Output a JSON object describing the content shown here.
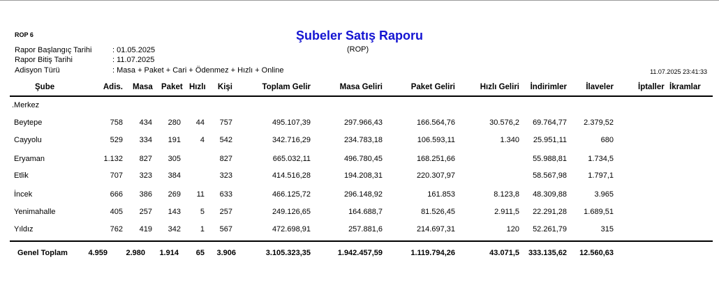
{
  "report": {
    "code": "ROP 6",
    "title": "Şubeler Satış Raporu",
    "subtitle": "(ROP)",
    "timestamp": "11.07.2025 23:41:33",
    "meta": [
      {
        "label": "Rapor Başlangıç Tarihi",
        "value": ": 01.05.2025"
      },
      {
        "label": "Rapor Bitiş Tarihi",
        "value": ": 11.07.2025"
      },
      {
        "label": "Adisyon Türü",
        "value": ": Masa + Paket + Cari + Ödenmez + Hızlı + Online"
      }
    ]
  },
  "table": {
    "headers": [
      "Şube",
      "Adis.",
      "Masa",
      "Paket",
      "Hızlı",
      "Kişi",
      "Toplam Gelir",
      "Masa Geliri",
      "Paket Geliri",
      "Hızlı Geliri",
      "İndirimler",
      "İlaveler",
      "İptaller",
      "İkramlar"
    ],
    "group": ".Merkez",
    "rows": [
      [
        "Beytepe",
        "758",
        "434",
        "280",
        "44",
        "757",
        "495.107,39",
        "297.966,43",
        "166.564,76",
        "30.576,2",
        "69.764,77",
        "2.379,52",
        "",
        ""
      ],
      [
        "Cayyolu",
        "529",
        "334",
        "191",
        "4",
        "542",
        "342.716,29",
        "234.783,18",
        "106.593,11",
        "1.340",
        "25.951,11",
        "680",
        "",
        ""
      ],
      [
        "Eryaman",
        "1.132",
        "827",
        "305",
        "",
        "827",
        "665.032,11",
        "496.780,45",
        "168.251,66",
        "",
        "55.988,81",
        "1.734,5",
        "",
        ""
      ],
      [
        "Etlik",
        "707",
        "323",
        "384",
        "",
        "323",
        "414.516,28",
        "194.208,31",
        "220.307,97",
        "",
        "58.567,98",
        "1.797,1",
        "",
        ""
      ],
      [
        "İncek",
        "666",
        "386",
        "269",
        "11",
        "633",
        "466.125,72",
        "296.148,92",
        "161.853",
        "8.123,8",
        "48.309,88",
        "3.965",
        "",
        ""
      ],
      [
        "Yenimahalle",
        "405",
        "257",
        "143",
        "5",
        "257",
        "249.126,65",
        "164.688,7",
        "81.526,45",
        "2.911,5",
        "22.291,28",
        "1.689,51",
        "",
        ""
      ],
      [
        "Yıldız",
        "762",
        "419",
        "342",
        "1",
        "567",
        "472.698,91",
        "257.881,6",
        "214.697,31",
        "120",
        "52.261,79",
        "315",
        "",
        ""
      ]
    ],
    "total": [
      "Genel Toplam",
      "4.959",
      "2.980",
      "1.914",
      "65",
      "3.906",
      "3.105.323,35",
      "1.942.457,59",
      "1.119.794,26",
      "43.071,5",
      "333.135,62",
      "12.560,63",
      "",
      ""
    ]
  }
}
